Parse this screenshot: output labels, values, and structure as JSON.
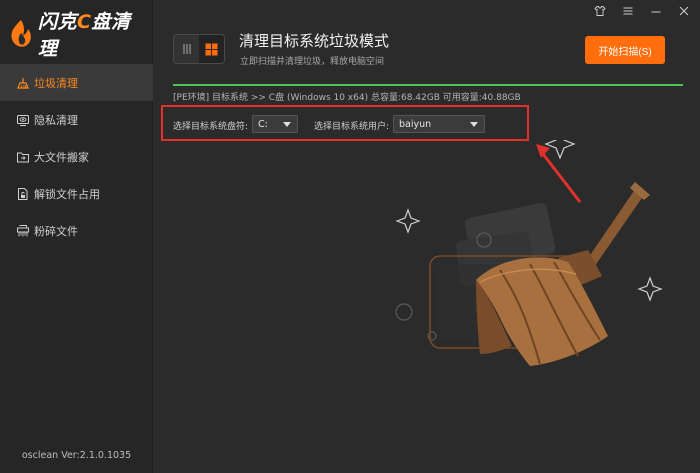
{
  "app": {
    "logo_text_a": "闪克",
    "logo_text_c": "C",
    "logo_text_b": "盘清理",
    "version": "osclean Ver:2.1.0.1035"
  },
  "sidebar": {
    "items": [
      {
        "label": "垃圾清理",
        "icon": "broom-icon",
        "active": true
      },
      {
        "label": "隐私清理",
        "icon": "eye-icon",
        "active": false
      },
      {
        "label": "大文件搬家",
        "icon": "folder-move-icon",
        "active": false
      },
      {
        "label": "解锁文件占用",
        "icon": "unlock-file-icon",
        "active": false
      },
      {
        "label": "粉碎文件",
        "icon": "shred-icon",
        "active": false
      }
    ]
  },
  "header": {
    "title": "清理目标系统垃圾模式",
    "subtitle": "立即扫描并清理垃圾，释放电脑空间",
    "start_button": "开始扫描(S)"
  },
  "system_info": "[PE环境] 目标系统 >> C盘 (Windows 10 x64) 总容量:68.42GB 可用容量:40.88GB",
  "selection": {
    "drive_label": "选择目标系统盘符:",
    "drive_value": "C:",
    "user_label": "选择目标系统用户:",
    "user_value": "baiyun"
  },
  "colors": {
    "accent": "#ff6d0c",
    "highlight_box": "#e0312a",
    "progress": "#4fc25a"
  }
}
